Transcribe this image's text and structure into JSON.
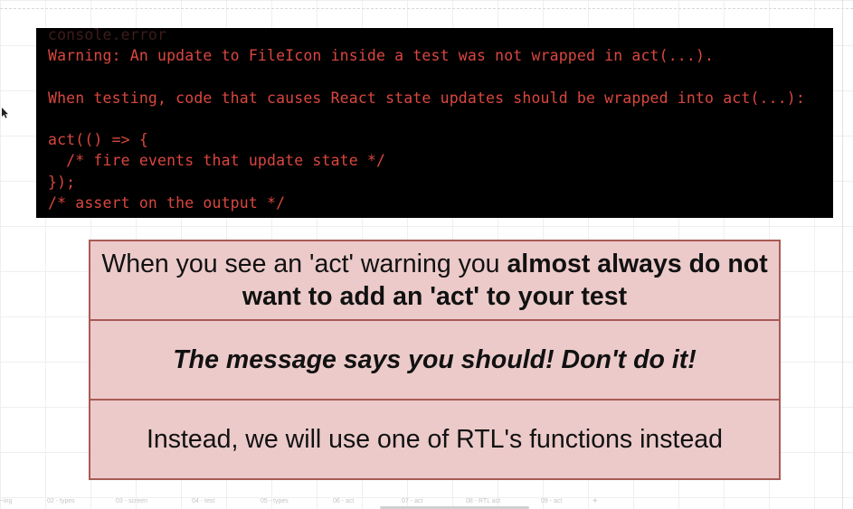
{
  "console": {
    "header": "console.error",
    "message": "Warning: An update to FileIcon inside a test was not wrapped in act(...).\n\nWhen testing, code that causes React state updates should be wrapped into act(...):\n\nact(() => {\n  /* fire events that update state */\n});\n/* assert on the output */",
    "text_color": "#d9473f",
    "background": "#000000"
  },
  "callouts": {
    "row1_prefix": "When you see an 'act' warning you ",
    "row1_bold": "almost always do not want to add an 'act' to your test",
    "row2": "The message says you should! Don't do it!",
    "row3": "Instead, we will use one of RTL's functions instead",
    "fill": "#eccaca",
    "border": "#a85a55"
  },
  "bottom_tabs": {
    "tabs": [
      "~ing",
      "02 - types",
      "03 - screen",
      "04 - test",
      "05 - types",
      "06 - act",
      "07 - act",
      "08 - RTL act",
      "09 - act",
      "+"
    ]
  },
  "icons": {
    "cursor": "mouse-pointer-icon",
    "add_tab": "plus-icon"
  }
}
